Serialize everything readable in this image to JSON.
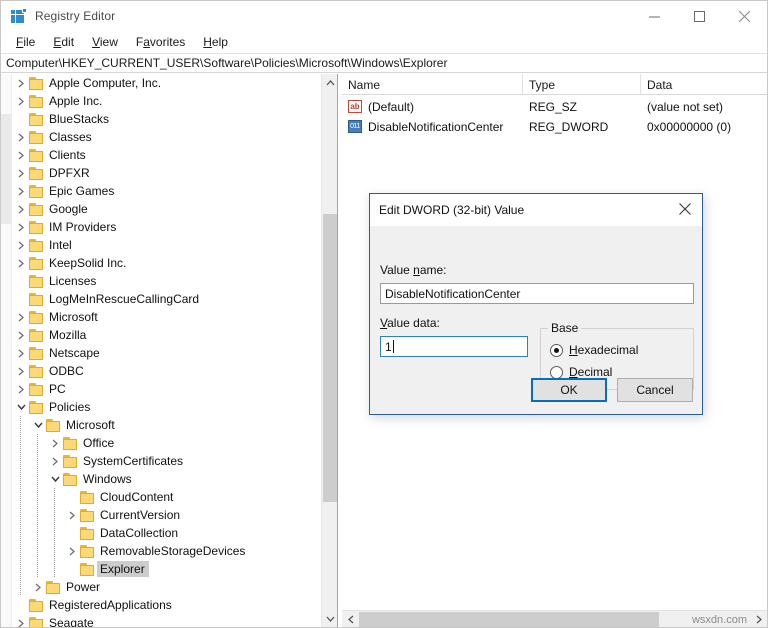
{
  "window": {
    "title": "Registry Editor",
    "icon": "registry-icon",
    "controls": {
      "minimize": "minimize-icon",
      "maximize": "maximize-icon",
      "close": "close-icon"
    }
  },
  "menu": {
    "items": [
      "File",
      "Edit",
      "View",
      "Favorites",
      "Help"
    ]
  },
  "address": {
    "path": "Computer\\HKEY_CURRENT_USER\\Software\\Policies\\Microsoft\\Windows\\Explorer"
  },
  "tree": {
    "nodes": [
      {
        "label": "Apple Computer, Inc.",
        "depth": 1,
        "state": "collapsed"
      },
      {
        "label": "Apple Inc.",
        "depth": 1,
        "state": "collapsed"
      },
      {
        "label": "BlueStacks",
        "depth": 1,
        "state": "leaf"
      },
      {
        "label": "Classes",
        "depth": 1,
        "state": "collapsed"
      },
      {
        "label": "Clients",
        "depth": 1,
        "state": "collapsed"
      },
      {
        "label": "DPFXR",
        "depth": 1,
        "state": "collapsed"
      },
      {
        "label": "Epic Games",
        "depth": 1,
        "state": "collapsed"
      },
      {
        "label": "Google",
        "depth": 1,
        "state": "collapsed"
      },
      {
        "label": "IM Providers",
        "depth": 1,
        "state": "collapsed"
      },
      {
        "label": "Intel",
        "depth": 1,
        "state": "collapsed"
      },
      {
        "label": "KeepSolid Inc.",
        "depth": 1,
        "state": "collapsed"
      },
      {
        "label": "Licenses",
        "depth": 1,
        "state": "leaf"
      },
      {
        "label": "LogMeInRescueCallingCard",
        "depth": 1,
        "state": "leaf"
      },
      {
        "label": "Microsoft",
        "depth": 1,
        "state": "collapsed"
      },
      {
        "label": "Mozilla",
        "depth": 1,
        "state": "collapsed"
      },
      {
        "label": "Netscape",
        "depth": 1,
        "state": "collapsed"
      },
      {
        "label": "ODBC",
        "depth": 1,
        "state": "collapsed"
      },
      {
        "label": "PC",
        "depth": 1,
        "state": "collapsed"
      },
      {
        "label": "Policies",
        "depth": 1,
        "state": "expanded"
      },
      {
        "label": "Microsoft",
        "depth": 2,
        "state": "expanded"
      },
      {
        "label": "Office",
        "depth": 3,
        "state": "collapsed"
      },
      {
        "label": "SystemCertificates",
        "depth": 3,
        "state": "collapsed"
      },
      {
        "label": "Windows",
        "depth": 3,
        "state": "expanded"
      },
      {
        "label": "CloudContent",
        "depth": 4,
        "state": "leaf"
      },
      {
        "label": "CurrentVersion",
        "depth": 4,
        "state": "collapsed"
      },
      {
        "label": "DataCollection",
        "depth": 4,
        "state": "leaf"
      },
      {
        "label": "RemovableStorageDevices",
        "depth": 4,
        "state": "collapsed"
      },
      {
        "label": "Explorer",
        "depth": 4,
        "state": "leaf",
        "selected": true
      },
      {
        "label": "Power",
        "depth": 2,
        "state": "collapsed"
      },
      {
        "label": "RegisteredApplications",
        "depth": 1,
        "state": "leaf"
      },
      {
        "label": "Seagate",
        "depth": 1,
        "state": "collapsed"
      }
    ]
  },
  "values": {
    "columns": [
      "Name",
      "Type",
      "Data"
    ],
    "rows": [
      {
        "icon": "string-value-icon",
        "icon_text": "ab",
        "name": "(Default)",
        "type": "REG_SZ",
        "data": "(value not set)"
      },
      {
        "icon": "dword-value-icon",
        "icon_text": "011",
        "name": "DisableNotificationCenter",
        "type": "REG_DWORD",
        "data": "0x00000000 (0)"
      }
    ]
  },
  "dialog": {
    "title": "Edit DWORD (32-bit) Value",
    "close_icon": "close-icon",
    "value_name_label": "Value name:",
    "value_name": "DisableNotificationCenter",
    "value_data_label": "Value data:",
    "value_data": "1",
    "base_group_label": "Base",
    "base_options": [
      {
        "label": "Hexadecimal",
        "selected": true
      },
      {
        "label": "Decimal",
        "selected": false
      }
    ],
    "ok_label": "OK",
    "cancel_label": "Cancel"
  },
  "statusbar": {
    "watermark": "wsxdn.com"
  },
  "colors": {
    "dialog_border": "#2a5f9e",
    "focus_border": "#0a6cbd",
    "folder": "#fcd974",
    "selection": "#cdcdcd",
    "dword_icon": "#4a7ebb",
    "string_icon": "#c0392b"
  }
}
